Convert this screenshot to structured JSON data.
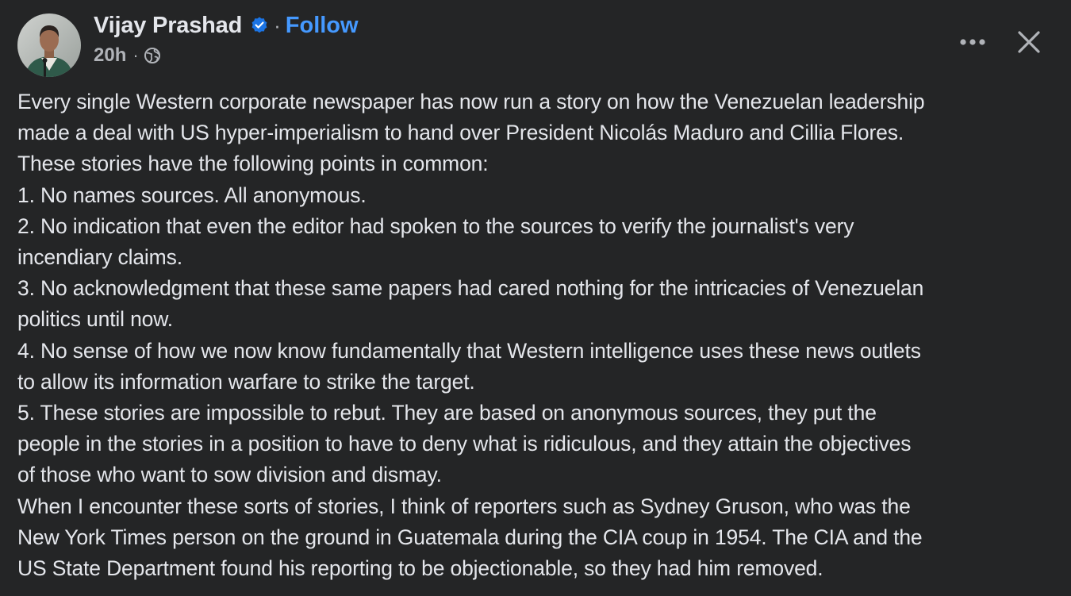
{
  "post": {
    "author": {
      "name": "Vijay Prashad",
      "verified": true,
      "follow_label": "Follow",
      "separator": "·"
    },
    "meta": {
      "timestamp": "20h",
      "separator": "·",
      "audience_icon": "globe-icon"
    },
    "actions": {
      "more_icon": "more-horizontal-icon",
      "close_icon": "close-icon"
    },
    "body_lines": [
      "Every single Western corporate newspaper has now run a story on how the Venezuelan leadership",
      "made a deal with US hyper-imperialism to hand over President Nicolás Maduro and Cillia Flores.",
      "These stories have the following points in common:",
      "1. No names sources. All anonymous.",
      "2. No indication that even the editor had spoken to the sources to verify the journalist's very",
      "incendiary claims.",
      "3. No acknowledgment that these same papers had cared nothing for the intricacies of Venezuelan",
      "politics until now.",
      "4. No sense of how we now know fundamentally that Western intelligence uses these news outlets",
      "to allow its information warfare to strike the target.",
      "5. These stories are impossible to rebut. They are based on anonymous sources, they put the",
      "people in the stories in a position to have to deny what is ridiculous, and they attain the objectives",
      "of those who want to sow division and dismay.",
      "When I encounter these sorts of stories, I think of reporters such as Sydney Gruson, who was the",
      "New York Times person on the ground in Guatemala during the CIA coup in 1954. The CIA and the",
      "US State Department found his reporting to be objectionable, so they had him removed."
    ]
  },
  "colors": {
    "background": "#242526",
    "primary_text": "#e4e6eb",
    "secondary_text": "#b0b3b8",
    "link_blue": "#4599ff",
    "verified_badge": "#1b74e4"
  }
}
